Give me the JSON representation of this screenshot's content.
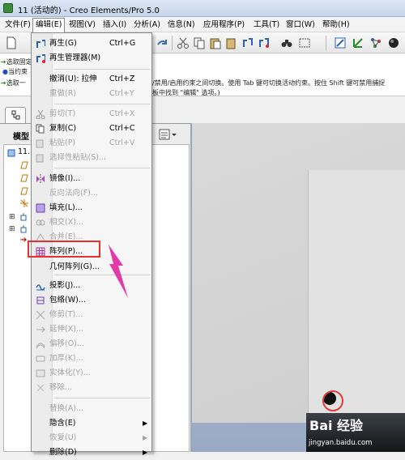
{
  "window": {
    "title": "11 (活动的) - Creo Elements/Pro 5.0"
  },
  "menubar": [
    {
      "label": "文件(F)"
    },
    {
      "label": "编辑(E)"
    },
    {
      "label": "视图(V)"
    },
    {
      "label": "插入(I)"
    },
    {
      "label": "分析(A)"
    },
    {
      "label": "信息(N)"
    },
    {
      "label": "应用程序(P)"
    },
    {
      "label": "工具(T)"
    },
    {
      "label": "窗口(W)"
    },
    {
      "label": "帮助(H)"
    }
  ],
  "messages": {
    "line1": "选取固定",
    "line2": "当约束",
    "line2_tail": "/禁用/启用约束之间切换。使用 Tab 键可切换活动约束。按住 Shift 键可禁用捕捉",
    "line3": "选取一",
    "line3_tail": "板中找到 \"编辑\" 选项。)"
  },
  "left_panel": {
    "tree_header": "模型",
    "root_item": "11.P"
  },
  "edit_menu": [
    {
      "label": "再生(G)",
      "shortcut": "Ctrl+G",
      "icon": "regenerate-icon",
      "disabled": false
    },
    {
      "label": "再生管理器(M)",
      "shortcut": "",
      "icon": "regen-manager-icon",
      "disabled": false
    },
    {
      "label": "撤消(U): 拉伸",
      "shortcut": "Ctrl+Z",
      "icon": "",
      "disabled": false
    },
    {
      "label": "重做(R)",
      "shortcut": "Ctrl+Y",
      "icon": "",
      "disabled": true
    },
    {
      "label": "剪切(T)",
      "shortcut": "Ctrl+X",
      "icon": "cut-icon",
      "disabled": true
    },
    {
      "label": "复制(C)",
      "shortcut": "Ctrl+C",
      "icon": "copy-icon",
      "disabled": false
    },
    {
      "label": "粘贴(P)",
      "shortcut": "Ctrl+V",
      "icon": "paste-icon",
      "disabled": true
    },
    {
      "label": "选择性粘贴(S)...",
      "shortcut": "",
      "icon": "paste-special-icon",
      "disabled": true
    },
    {
      "label": "镜像(I)...",
      "shortcut": "",
      "icon": "mirror-icon",
      "disabled": false
    },
    {
      "label": "反向法向(F)...",
      "shortcut": "",
      "icon": "",
      "disabled": true
    },
    {
      "label": "填充(L)...",
      "shortcut": "",
      "icon": "fill-icon",
      "disabled": false
    },
    {
      "label": "相交(X)...",
      "shortcut": "",
      "icon": "intersect-icon",
      "disabled": true
    },
    {
      "label": "合并(E)...",
      "shortcut": "",
      "icon": "merge-icon",
      "disabled": true
    },
    {
      "label": "阵列(P)...",
      "shortcut": "",
      "icon": "pattern-icon",
      "disabled": false
    },
    {
      "label": "几何阵列(G)...",
      "shortcut": "",
      "icon": "",
      "disabled": false
    },
    {
      "label": "投影(J)...",
      "shortcut": "",
      "icon": "project-icon",
      "disabled": false
    },
    {
      "label": "包络(W)...",
      "shortcut": "",
      "icon": "wrap-icon",
      "disabled": false
    },
    {
      "label": "修剪(T)...",
      "shortcut": "",
      "icon": "trim-icon",
      "disabled": true
    },
    {
      "label": "延伸(X)...",
      "shortcut": "",
      "icon": "extend-icon",
      "disabled": true
    },
    {
      "label": "偏移(O)...",
      "shortcut": "",
      "icon": "offset-icon",
      "disabled": true
    },
    {
      "label": "加厚(K)...",
      "shortcut": "",
      "icon": "thicken-icon",
      "disabled": true
    },
    {
      "label": "实体化(Y)...",
      "shortcut": "",
      "icon": "solidify-icon",
      "disabled": true
    },
    {
      "label": "移除...",
      "shortcut": "",
      "icon": "remove-icon",
      "disabled": true
    },
    {
      "label": "替换(A)...",
      "shortcut": "",
      "icon": "",
      "disabled": true
    },
    {
      "label": "隐含(E)",
      "shortcut": "",
      "icon": "",
      "disabled": false,
      "submenu": true
    },
    {
      "label": "恢复(U)",
      "shortcut": "",
      "icon": "",
      "disabled": true,
      "submenu": true
    },
    {
      "label": "删除(D)",
      "shortcut": "",
      "icon": "",
      "disabled": false,
      "submenu": true
    }
  ],
  "watermark": {
    "brand": "Bai 经验",
    "url": "jingyan.baidu.com"
  }
}
